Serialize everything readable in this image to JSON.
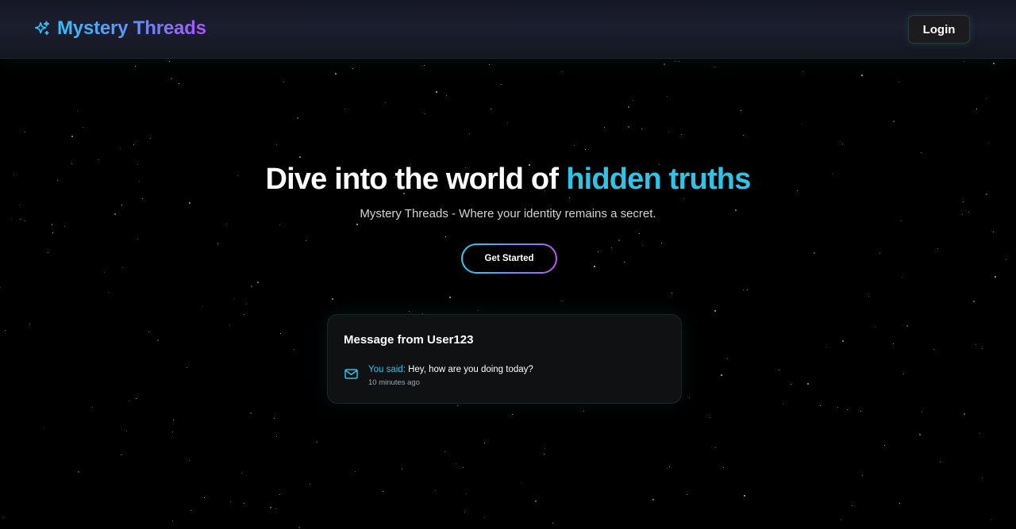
{
  "nav": {
    "brand_name": "Mystery Threads",
    "brand_icon": "sparkles-icon",
    "login_label": "Login"
  },
  "hero": {
    "title_main": "Dive into the world of",
    "title_accent": "hidden truths",
    "subtitle": "Mystery Threads - Where your identity remains a secret.",
    "cta_label": "Get Started"
  },
  "message_card": {
    "title": "Message from User123",
    "icon": "mail-icon",
    "prefix": "You said:",
    "text": "Hey, how are you doing today?",
    "time": "10 minutes ago"
  },
  "colors": {
    "accent": "#2ec4e6",
    "brand_gradient_start": "#38bdf8",
    "brand_gradient_end": "#a855f7",
    "background": "#000000"
  }
}
